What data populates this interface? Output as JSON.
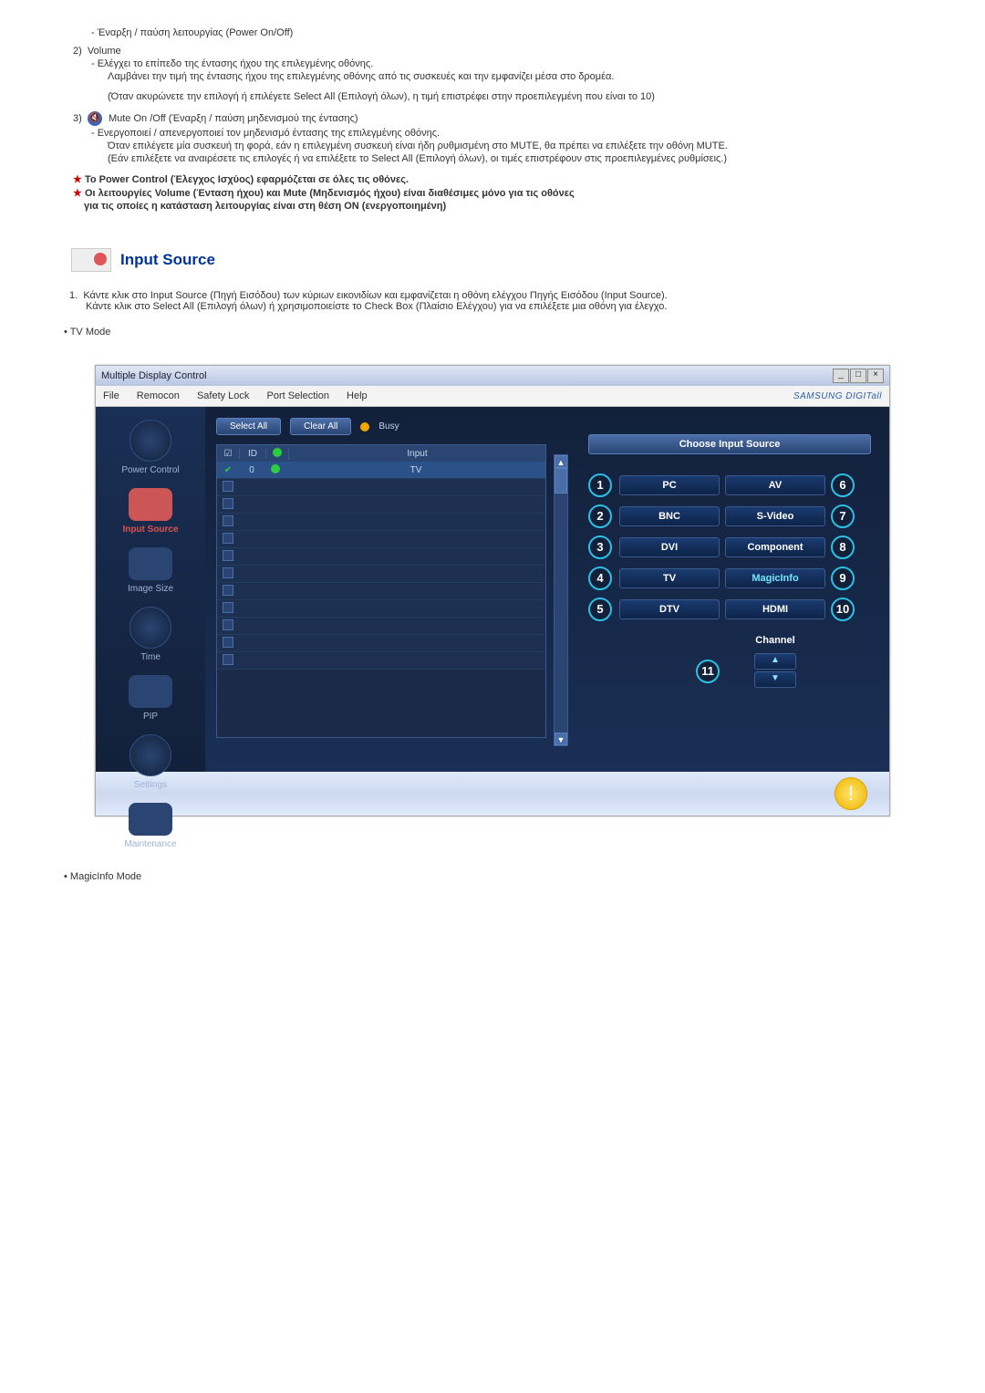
{
  "top": {
    "power_onoff": "- Έναρξη / παύση λειτουργίας (Power On/Off)",
    "num2": "2)",
    "volume_lbl": "Volume",
    "vol_line1": "- Ελέγχει το επίπεδο της έντασης ήχου της επιλεγμένης οθόνης.",
    "vol_line2": "Λαμβάνει την τιμή της έντασης ήχου της επιλεγμένης οθόνης από τις συσκευές και την εμφανίζει μέσα στο δρομέα.",
    "vol_paren": "(Όταν ακυρώνετε την επιλογή ή επιλέγετε Select All (Επιλογή όλων), η τιμή επιστρέφει στην προεπιλεγμένη που είναι το 10)",
    "num3": "3)",
    "mute_lbl": "Mute On /Off (Έναρξη / παύση μηδενισμού της έντασης)",
    "mute_line1": "- Ενεργοποιεί / απενεργοποιεί τον μηδενισμό έντασης της επιλεγμένης οθόνης.",
    "mute_line2": "Όταν επιλέγετε μία συσκευή τη φορά, εάν η επιλεγμένη συσκευή είναι ήδη ρυθμισμένη στο MUTE, θα πρέπει να επιλέξετε την οθόνη MUTE.",
    "mute_line3": "(Εάν επιλέξετε να αναιρέσετε τις επιλογές ή να επιλέξετε το Select All (Επιλογή όλων), οι τιμές επιστρέφουν στις προεπιλεγμένες ρυθμίσεις.)",
    "star1": "Το Power Control (Έλεγχος Ισχύος) εφαρμόζεται σε όλες τις οθόνες.",
    "star2a": "Οι λειτουργίες Volume (Ένταση ήχου) και Mute (Μηδενισμός ήχου) είναι διαθέσιμες μόνο για τις οθόνες",
    "star2b": "για τις οποίες η κατάσταση λειτουργίας είναι στη θέση ON (ενεργοποιημένη)"
  },
  "hdr": {
    "input_source": "Input Source"
  },
  "body": {
    "num1": "1.",
    "para1a": "Κάντε κλικ στο Input Source (Πηγή Εισόδου) των κύριων εικονιδίων και εμφανίζεται η οθόνη ελέγχου Πηγής Εισόδου (Input Source).",
    "para1b": "Κάντε κλικ στο Select All (Επιλογή όλων) ή χρησιμοποιείστε το Check Box (Πλαίσιο Ελέγχου) για να επιλέξετε μια οθόνη για έλεγχο.",
    "tv_mode": "• TV Mode"
  },
  "app": {
    "title": "Multiple Display Control",
    "menu": {
      "file": "File",
      "remocon": "Remocon",
      "safety": "Safety Lock",
      "port": "Port Selection",
      "help": "Help"
    },
    "samsung": "SAMSUNG DIGITall",
    "btn_select_all": "Select All",
    "btn_clear_all": "Clear All",
    "busy": "Busy",
    "grid_headers": {
      "id": "ID",
      "input": "Input"
    },
    "grid_row_id": "0",
    "grid_row_input": "TV",
    "sidebar": {
      "power": "Power Control",
      "input": "Input Source",
      "image": "Image Size",
      "time": "Time",
      "pip": "PIP",
      "settings": "Settings",
      "maint": "Maintenance"
    },
    "choose_title": "Choose Input Source",
    "sources": {
      "pc": "PC",
      "av": "AV",
      "bnc": "BNC",
      "svideo": "S-Video",
      "dvi": "DVI",
      "component": "Component",
      "tv": "TV",
      "magic": "MagicInfo",
      "dtv": "DTV",
      "hdmi": "HDMI"
    },
    "channel": "Channel",
    "nums": {
      "n1": "1",
      "n2": "2",
      "n3": "3",
      "n4": "4",
      "n5": "5",
      "n6": "6",
      "n7": "7",
      "n8": "8",
      "n9": "9",
      "n10": "10",
      "n11": "11"
    }
  },
  "footer": {
    "magic_mode": "• MagicInfo Mode"
  }
}
